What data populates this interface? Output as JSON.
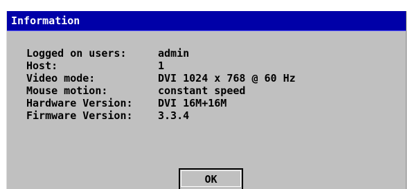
{
  "window": {
    "title": "Information"
  },
  "info": [
    {
      "label": "Logged on users:",
      "value": "admin"
    },
    {
      "label": "Host:",
      "value": "1"
    },
    {
      "label": "Video mode:",
      "value": "DVI 1024 x 768 @ 60 Hz"
    },
    {
      "label": "Mouse motion:",
      "value": "constant speed"
    },
    {
      "label": "Hardware Version:",
      "value": "DVI 16M+16M"
    },
    {
      "label": "Firmware Version:",
      "value": "3.3.4"
    }
  ],
  "buttons": {
    "ok_label": "OK"
  },
  "colors": {
    "titlebar": "#0000a8",
    "dialog_bg": "#c0c0c0",
    "title_text": "#ffffff"
  }
}
